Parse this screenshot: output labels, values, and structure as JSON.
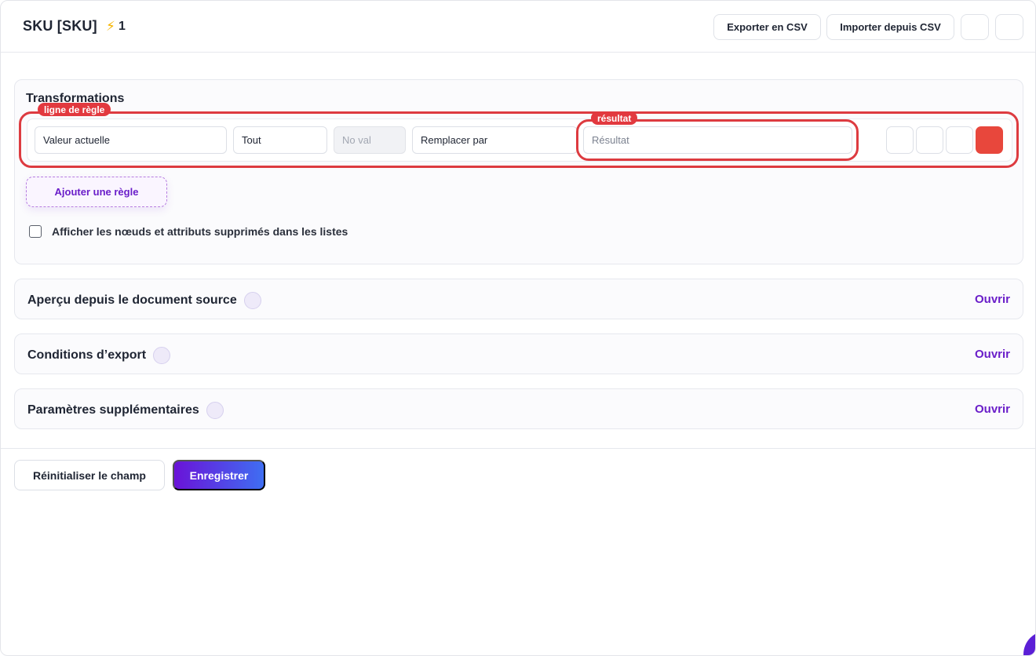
{
  "header": {
    "title": "SKU [SKU]",
    "badge_icon": "lightning-icon",
    "badge_count": "1",
    "export_label": "Exporter en CSV",
    "import_label": "Importer depuis CSV"
  },
  "transformations": {
    "title": "Transformations",
    "highlight_row_tag": "ligne de règle",
    "highlight_result_tag": "résultat",
    "rule": {
      "source": "Valeur actuelle",
      "scope": "Tout",
      "value_placeholder": "No val",
      "action": "Remplacer par",
      "result_placeholder": "Résultat"
    },
    "add_rule_label": "Ajouter une règle",
    "show_deleted_label": "Afficher les nœuds et attributs supprimés dans les listes",
    "show_deleted_checked": false
  },
  "sections": [
    {
      "title": "Aperçu depuis le document source",
      "action": "Ouvrir"
    },
    {
      "title": "Conditions d’export",
      "action": "Ouvrir"
    },
    {
      "title": "Paramètres supplémentaires",
      "action": "Ouvrir"
    }
  ],
  "footer": {
    "reset_label": "Réinitialiser le champ",
    "save_label": "Enregistrer"
  },
  "colors": {
    "accent": "#6a1ec9",
    "danger": "#e8473c",
    "highlight": "#dd3b40"
  }
}
